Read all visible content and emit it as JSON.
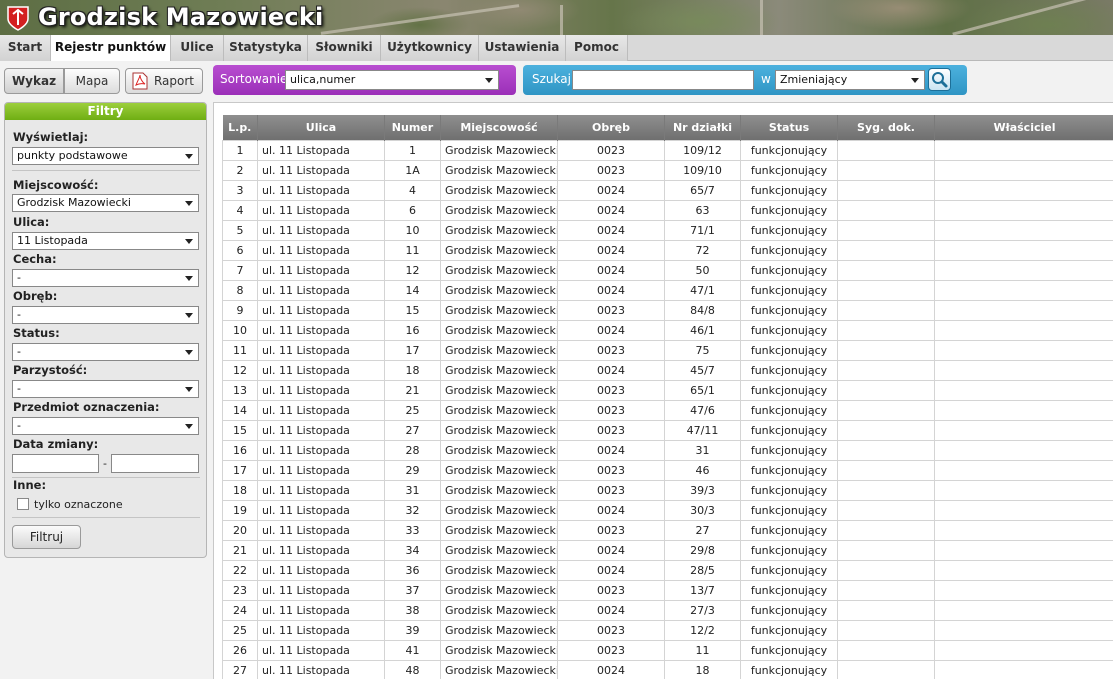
{
  "app": {
    "title": "Grodzisk Mazowiecki"
  },
  "nav": {
    "tabs": [
      "Start",
      "Rejestr punktów",
      "Ulice",
      "Statystyka",
      "Słowniki",
      "Użytkownicy",
      "Ustawienia",
      "Pomoc"
    ]
  },
  "view_buttons": {
    "list": "Wykaz",
    "map": "Mapa",
    "report": "Raport"
  },
  "sort": {
    "label": "Sortowanie",
    "value": "ulica,numer"
  },
  "search": {
    "label": "Szukaj",
    "value": "",
    "in_label": "w",
    "field": "Zmieniający"
  },
  "filters": {
    "title": "Filtry",
    "display_label": "Wyświetlaj:",
    "display_value": "punkty podstawowe",
    "locality_label": "Miejscowość:",
    "locality_value": "Grodzisk Mazowiecki",
    "street_label": "Ulica:",
    "street_value": "11 Listopada",
    "feature_label": "Cecha:",
    "feature_value": "-",
    "precinct_label": "Obręb:",
    "precinct_value": "-",
    "status_label": "Status:",
    "status_value": "-",
    "parity_label": "Parzystość:",
    "parity_value": "-",
    "subject_label": "Przedmiot oznaczenia:",
    "subject_value": "-",
    "date_label": "Data zmiany:",
    "date_separator": "-",
    "other_label": "Inne:",
    "checkbox_label": "tylko oznaczone",
    "filter_button": "Filtruj"
  },
  "table": {
    "headers": [
      "L.p.",
      "Ulica",
      "Numer",
      "Miejscowość",
      "Obręb",
      "Nr działki",
      "Status",
      "Syg. dok.",
      "Właściciel"
    ],
    "rows": [
      [
        "1",
        "ul. 11 Listopada",
        "1",
        "Grodzisk Mazowiecki",
        "0023",
        "109/12",
        "funkcjonujący",
        "",
        ""
      ],
      [
        "2",
        "ul. 11 Listopada",
        "1A",
        "Grodzisk Mazowiecki",
        "0023",
        "109/10",
        "funkcjonujący",
        "",
        ""
      ],
      [
        "3",
        "ul. 11 Listopada",
        "4",
        "Grodzisk Mazowiecki",
        "0024",
        "65/7",
        "funkcjonujący",
        "",
        ""
      ],
      [
        "4",
        "ul. 11 Listopada",
        "6",
        "Grodzisk Mazowiecki",
        "0024",
        "63",
        "funkcjonujący",
        "",
        ""
      ],
      [
        "5",
        "ul. 11 Listopada",
        "10",
        "Grodzisk Mazowiecki",
        "0024",
        "71/1",
        "funkcjonujący",
        "",
        ""
      ],
      [
        "6",
        "ul. 11 Listopada",
        "11",
        "Grodzisk Mazowiecki",
        "0024",
        "72",
        "funkcjonujący",
        "",
        ""
      ],
      [
        "7",
        "ul. 11 Listopada",
        "12",
        "Grodzisk Mazowiecki",
        "0024",
        "50",
        "funkcjonujący",
        "",
        ""
      ],
      [
        "8",
        "ul. 11 Listopada",
        "14",
        "Grodzisk Mazowiecki",
        "0024",
        "47/1",
        "funkcjonujący",
        "",
        ""
      ],
      [
        "9",
        "ul. 11 Listopada",
        "15",
        "Grodzisk Mazowiecki",
        "0023",
        "84/8",
        "funkcjonujący",
        "",
        ""
      ],
      [
        "10",
        "ul. 11 Listopada",
        "16",
        "Grodzisk Mazowiecki",
        "0024",
        "46/1",
        "funkcjonujący",
        "",
        ""
      ],
      [
        "11",
        "ul. 11 Listopada",
        "17",
        "Grodzisk Mazowiecki",
        "0023",
        "75",
        "funkcjonujący",
        "",
        ""
      ],
      [
        "12",
        "ul. 11 Listopada",
        "18",
        "Grodzisk Mazowiecki",
        "0024",
        "45/7",
        "funkcjonujący",
        "",
        ""
      ],
      [
        "13",
        "ul. 11 Listopada",
        "21",
        "Grodzisk Mazowiecki",
        "0023",
        "65/1",
        "funkcjonujący",
        "",
        ""
      ],
      [
        "14",
        "ul. 11 Listopada",
        "25",
        "Grodzisk Mazowiecki",
        "0023",
        "47/6",
        "funkcjonujący",
        "",
        ""
      ],
      [
        "15",
        "ul. 11 Listopada",
        "27",
        "Grodzisk Mazowiecki",
        "0023",
        "47/11",
        "funkcjonujący",
        "",
        ""
      ],
      [
        "16",
        "ul. 11 Listopada",
        "28",
        "Grodzisk Mazowiecki",
        "0024",
        "31",
        "funkcjonujący",
        "",
        ""
      ],
      [
        "17",
        "ul. 11 Listopada",
        "29",
        "Grodzisk Mazowiecki",
        "0023",
        "46",
        "funkcjonujący",
        "",
        ""
      ],
      [
        "18",
        "ul. 11 Listopada",
        "31",
        "Grodzisk Mazowiecki",
        "0023",
        "39/3",
        "funkcjonujący",
        "",
        ""
      ],
      [
        "19",
        "ul. 11 Listopada",
        "32",
        "Grodzisk Mazowiecki",
        "0024",
        "30/3",
        "funkcjonujący",
        "",
        ""
      ],
      [
        "20",
        "ul. 11 Listopada",
        "33",
        "Grodzisk Mazowiecki",
        "0023",
        "27",
        "funkcjonujący",
        "",
        ""
      ],
      [
        "21",
        "ul. 11 Listopada",
        "34",
        "Grodzisk Mazowiecki",
        "0024",
        "29/8",
        "funkcjonujący",
        "",
        ""
      ],
      [
        "22",
        "ul. 11 Listopada",
        "36",
        "Grodzisk Mazowiecki",
        "0024",
        "28/5",
        "funkcjonujący",
        "",
        ""
      ],
      [
        "23",
        "ul. 11 Listopada",
        "37",
        "Grodzisk Mazowiecki",
        "0023",
        "13/7",
        "funkcjonujący",
        "",
        ""
      ],
      [
        "24",
        "ul. 11 Listopada",
        "38",
        "Grodzisk Mazowiecki",
        "0024",
        "27/3",
        "funkcjonujący",
        "",
        ""
      ],
      [
        "25",
        "ul. 11 Listopada",
        "39",
        "Grodzisk Mazowiecki",
        "0023",
        "12/2",
        "funkcjonujący",
        "",
        ""
      ],
      [
        "26",
        "ul. 11 Listopada",
        "41",
        "Grodzisk Mazowiecki",
        "0023",
        "11",
        "funkcjonujący",
        "",
        ""
      ],
      [
        "27",
        "ul. 11 Listopada",
        "48",
        "Grodzisk Mazowiecki",
        "0024",
        "18",
        "funkcjonujący",
        "",
        ""
      ]
    ]
  },
  "icons": {
    "logo": "city-emblem-icon",
    "pdf": "pdf-icon",
    "search": "magnifier-icon",
    "caret": "chevron-down-icon"
  },
  "colors": {
    "sort_bar": "#a43cc2",
    "search_bar": "#3aa2d1",
    "filters_header": "#84c027",
    "table_header": "#7d7d7d"
  }
}
